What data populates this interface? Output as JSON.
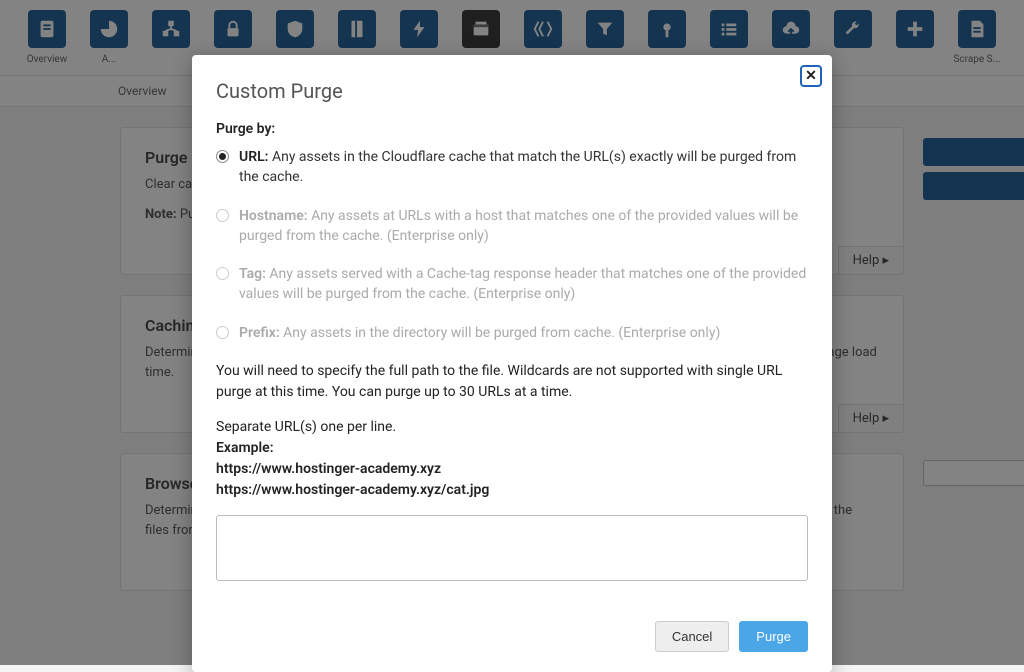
{
  "topnav": {
    "items": [
      {
        "label": "Overview",
        "icon": "doc"
      },
      {
        "label": "A...",
        "icon": "pie"
      },
      {
        "label": "",
        "icon": "site"
      },
      {
        "label": "",
        "icon": "lock"
      },
      {
        "label": "",
        "icon": "shield"
      },
      {
        "label": "",
        "icon": "book"
      },
      {
        "label": "",
        "icon": "bolt"
      },
      {
        "label": "",
        "icon": "cache",
        "active": true
      },
      {
        "label": "",
        "icon": "workers"
      },
      {
        "label": "",
        "icon": "filter"
      },
      {
        "label": "",
        "icon": "pin"
      },
      {
        "label": "",
        "icon": "list"
      },
      {
        "label": "",
        "icon": "cloud"
      },
      {
        "label": "",
        "icon": "wrench"
      },
      {
        "label": "",
        "icon": "plus"
      },
      {
        "label": "Scrape S...",
        "icon": "page"
      }
    ]
  },
  "subnav": {
    "label": "Overview"
  },
  "cards": {
    "purge": {
      "title": "Purge",
      "p1": "Clear cached files to force Cloudflare to fetch a fresh version of those files from your web server.",
      "note_label": "Note:",
      "note_text": " Purging the cache may temporarily degrade performance for your website and increase load on your origin.",
      "help": "Help"
    },
    "caching": {
      "title": "Caching",
      "p1": "Determine how much of your website's static content you want Cloudflare to cache. Increasing caching can speed up page load time.",
      "help": "Help"
    },
    "browser": {
      "title": "Browser",
      "p1": "Determine the length of time Cloudflare instructs a visitor's browser to cache files. During this period, the browser loads the files from its local cache, speeding up page loads."
    }
  },
  "modal": {
    "title": "Custom Purge",
    "purge_by": "Purge by:",
    "options": [
      {
        "label": "URL:",
        "desc": " Any assets in the Cloudflare cache that match the URL(s) exactly will be purged from the cache.",
        "enabled": true,
        "selected": true
      },
      {
        "label": "Hostname:",
        "desc": " Any assets at URLs with a host that matches one of the provided values will be purged from the cache. (Enterprise only)",
        "enabled": false,
        "selected": false
      },
      {
        "label": "Tag:",
        "desc": " Any assets served with a Cache-tag response header that matches one of the provided values will be purged from the cache. (Enterprise only)",
        "enabled": false,
        "selected": false
      },
      {
        "label": "Prefix:",
        "desc": " Any assets in the directory will be purged from cache. (Enterprise only)",
        "enabled": false,
        "selected": false
      }
    ],
    "info1": "You will need to specify the full path to the file. Wildcards are not supported with single URL purge at this time. You can purge up to 30 URLs at a time.",
    "info2": "Separate URL(s) one per line.",
    "example_label": "Example:",
    "example1": "https://www.hostinger-academy.xyz",
    "example2": "https://www.hostinger-academy.xyz/cat.jpg",
    "cancel": "Cancel",
    "purge": "Purge",
    "close": "✕"
  }
}
